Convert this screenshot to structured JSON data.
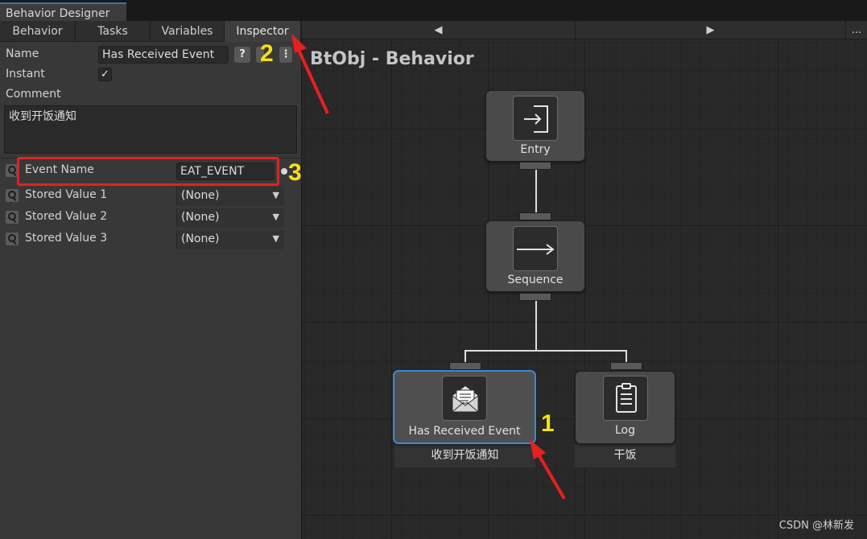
{
  "window": {
    "tab_title": "Behavior Designer"
  },
  "left_tabs": [
    "Behavior",
    "Tasks",
    "Variables",
    "Inspector"
  ],
  "inspector": {
    "name_label": "Name",
    "name_value": "Has Received Event",
    "help_btn": "?",
    "menu_btn": "⋮",
    "instant_label": "Instant",
    "instant_checked": "✓",
    "comment_label": "Comment",
    "comment_value": "收到开饭通知",
    "fields": [
      {
        "label": "Event Name",
        "value": "EAT_EVENT"
      },
      {
        "label": "Stored Value 1",
        "value": "(None)"
      },
      {
        "label": "Stored Value 2",
        "value": "(None)"
      },
      {
        "label": "Stored Value 3",
        "value": "(None)"
      }
    ]
  },
  "toolbar": {
    "prev": "◀",
    "next": "▶",
    "more": "..."
  },
  "graph": {
    "title": "BtObj - Behavior",
    "nodes": {
      "entry": {
        "label": "Entry"
      },
      "sequence": {
        "label": "Sequence"
      },
      "received": {
        "label": "Has Received Event",
        "comment": "收到开饭通知"
      },
      "log": {
        "label": "Log",
        "comment": "干饭"
      }
    }
  },
  "annotations": {
    "one": "1",
    "two": "2",
    "three": "3"
  },
  "watermark": "CSDN @林新发",
  "colors": {
    "highlight": "#e52020",
    "callout": "#f6e10e",
    "selection": "#3f86d6"
  }
}
